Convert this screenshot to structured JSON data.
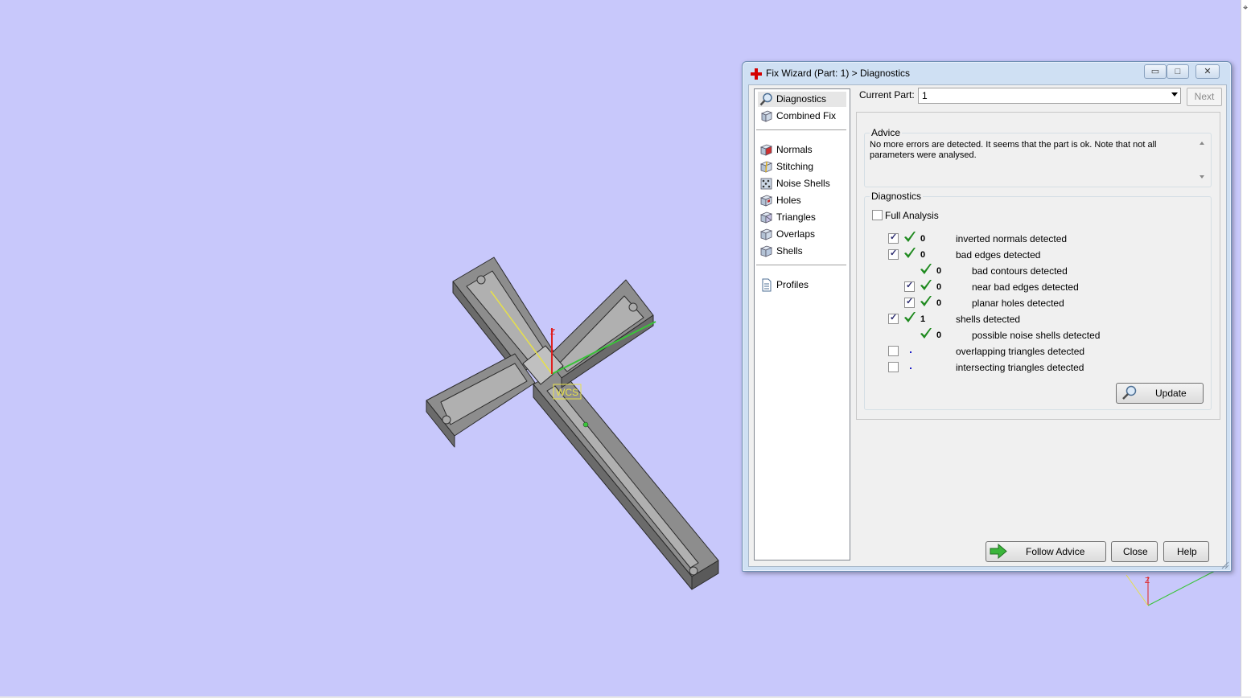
{
  "window": {
    "title": "Fix Wizard (Part: 1) > Diagnostics",
    "min_label": "▭",
    "max_label": "□",
    "close_label": "✕"
  },
  "viewport": {
    "wcs_label": "WCS",
    "axis_z_label": "Z",
    "mini_axis_z_label": "Z",
    "rightbar_tick": "⌖",
    "background_color": "#c8c8fb"
  },
  "nav": {
    "items": [
      {
        "label": "Diagnostics",
        "icon": "magnifier-icon",
        "selected": true
      },
      {
        "label": "Combined Fix",
        "icon": "cube-icon"
      },
      {
        "label": "Normals",
        "icon": "normals-cube-icon"
      },
      {
        "label": "Stitching",
        "icon": "stitching-cube-icon"
      },
      {
        "label": "Noise Shells",
        "icon": "noise-shells-icon"
      },
      {
        "label": "Holes",
        "icon": "holes-cube-icon"
      },
      {
        "label": "Triangles",
        "icon": "triangles-cube-icon"
      },
      {
        "label": "Overlaps",
        "icon": "overlaps-cube-icon"
      },
      {
        "label": "Shells",
        "icon": "shells-cube-icon"
      },
      {
        "label": "Profiles",
        "icon": "document-icon"
      }
    ]
  },
  "header": {
    "current_part_label": "Current Part:",
    "current_part_value": "1",
    "next_label": "Next"
  },
  "advice": {
    "caption": "Advice",
    "text": "No more errors are detected. It seems that the part is ok. Note that not all parameters were analysed."
  },
  "diagnostics": {
    "caption": "Diagnostics",
    "full_analysis_label": "Full Analysis",
    "full_analysis_checked": false,
    "rows": [
      {
        "checkbox": true,
        "checked": true,
        "status": "ok",
        "count": "0",
        "label": "inverted normals detected",
        "indent": 0
      },
      {
        "checkbox": true,
        "checked": true,
        "status": "ok",
        "count": "0",
        "label": "bad edges detected",
        "indent": 0
      },
      {
        "checkbox": false,
        "checked": false,
        "status": "ok",
        "count": "0",
        "label": "bad contours detected",
        "indent": 1
      },
      {
        "checkbox": true,
        "checked": true,
        "status": "ok",
        "count": "0",
        "label": "near bad edges detected",
        "indent": 1
      },
      {
        "checkbox": true,
        "checked": true,
        "status": "ok",
        "count": "0",
        "label": "planar holes detected",
        "indent": 1
      },
      {
        "checkbox": true,
        "checked": true,
        "status": "ok",
        "count": "1",
        "label": "shells detected",
        "indent": 0
      },
      {
        "checkbox": false,
        "checked": false,
        "status": "ok",
        "count": "0",
        "label": "possible noise shells detected",
        "indent": 1
      },
      {
        "checkbox": true,
        "checked": false,
        "status": "pending",
        "count": "",
        "label": "overlapping triangles detected",
        "indent": 0
      },
      {
        "checkbox": true,
        "checked": false,
        "status": "pending",
        "count": "",
        "label": "intersecting triangles detected",
        "indent": 0
      }
    ],
    "update_label": "Update"
  },
  "footer": {
    "follow_advice_label": "Follow Advice",
    "close_label": "Close",
    "help_label": "Help"
  },
  "colors": {
    "check_green": "#1f8a1f",
    "title_icon_red": "#d40000",
    "arrow_green": "#3ab53a"
  }
}
